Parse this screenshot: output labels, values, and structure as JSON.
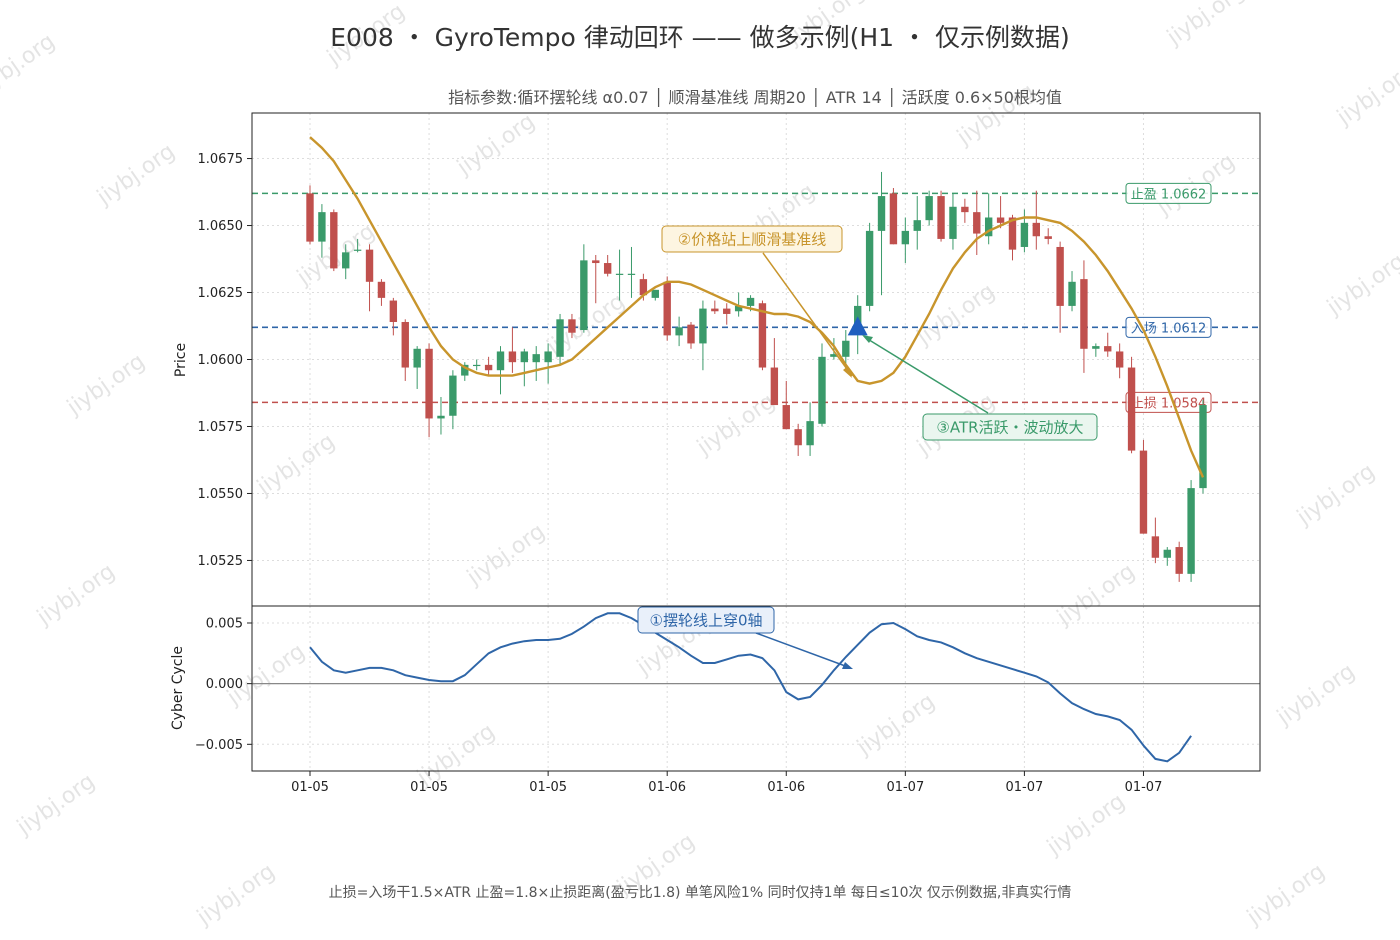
{
  "title": "E008 ・ GyroTempo 律动回环 —— 做多示例(H1 ・ 仅示例数据)",
  "subtitle": "指标参数:循环摆轮线 α0.07 │ 顺滑基准线 周期20 │ ATR 14 │ 活跃度 0.6×50根均值",
  "footer": "止损=入场干1.5×ATR  止盈=1.8×止损距离(盈亏比1.8)  单笔风险1%  同时仅持1单  每日≤10次     仅示例数据,非真实行情",
  "watermark": "jiybj.org",
  "colors": {
    "up": "#3a9a6a",
    "down": "#c0504d",
    "baseline": "#c8952c",
    "cycle": "#2f66a8",
    "take_profit": "#3a9a6a",
    "entry": "#2f66a8",
    "stop_loss": "#c0504d",
    "signal_marker": "#1f5fbf"
  },
  "chart_data": [
    {
      "type": "candlestick",
      "ylabel": "Price",
      "ylim": [
        1.0508,
        1.0692
      ],
      "yticks": [
        1.0525,
        1.055,
        1.0575,
        1.06,
        1.0625,
        1.065,
        1.0675
      ],
      "grid": true,
      "candles": [
        {
          "o": 1.0662,
          "h": 1.0665,
          "l": 1.0643,
          "c": 1.0644
        },
        {
          "o": 1.0644,
          "h": 1.0658,
          "l": 1.0638,
          "c": 1.0655
        },
        {
          "o": 1.0655,
          "h": 1.0656,
          "l": 1.0633,
          "c": 1.0634
        },
        {
          "o": 1.0634,
          "h": 1.0643,
          "l": 1.063,
          "c": 1.064
        },
        {
          "o": 1.0641,
          "h": 1.0645,
          "l": 1.064,
          "c": 1.0641
        },
        {
          "o": 1.0641,
          "h": 1.0643,
          "l": 1.0618,
          "c": 1.0629
        },
        {
          "o": 1.0629,
          "h": 1.063,
          "l": 1.062,
          "c": 1.0623
        },
        {
          "o": 1.0622,
          "h": 1.0623,
          "l": 1.0609,
          "c": 1.0614
        },
        {
          "o": 1.0614,
          "h": 1.0615,
          "l": 1.0592,
          "c": 1.0597
        },
        {
          "o": 1.0597,
          "h": 1.0605,
          "l": 1.0589,
          "c": 1.0604
        },
        {
          "o": 1.0604,
          "h": 1.0606,
          "l": 1.0571,
          "c": 1.0578
        },
        {
          "o": 1.0578,
          "h": 1.0586,
          "l": 1.0572,
          "c": 1.0579
        },
        {
          "o": 1.0579,
          "h": 1.0596,
          "l": 1.0574,
          "c": 1.0594
        },
        {
          "o": 1.0594,
          "h": 1.0599,
          "l": 1.0592,
          "c": 1.0598
        },
        {
          "o": 1.0598,
          "h": 1.06,
          "l": 1.0596,
          "c": 1.0598
        },
        {
          "o": 1.0598,
          "h": 1.0601,
          "l": 1.0594,
          "c": 1.0596
        },
        {
          "o": 1.0596,
          "h": 1.0605,
          "l": 1.0587,
          "c": 1.0603
        },
        {
          "o": 1.0603,
          "h": 1.0612,
          "l": 1.0595,
          "c": 1.0599
        },
        {
          "o": 1.0599,
          "h": 1.0604,
          "l": 1.059,
          "c": 1.0603
        },
        {
          "o": 1.0599,
          "h": 1.0605,
          "l": 1.0592,
          "c": 1.0602
        },
        {
          "o": 1.0599,
          "h": 1.0606,
          "l": 1.0591,
          "c": 1.0603
        },
        {
          "o": 1.0601,
          "h": 1.0617,
          "l": 1.0598,
          "c": 1.0615
        },
        {
          "o": 1.0615,
          "h": 1.0617,
          "l": 1.0608,
          "c": 1.061
        },
        {
          "o": 1.0611,
          "h": 1.0643,
          "l": 1.061,
          "c": 1.0637
        },
        {
          "o": 1.0637,
          "h": 1.0639,
          "l": 1.0621,
          "c": 1.0636
        },
        {
          "o": 1.0636,
          "h": 1.0639,
          "l": 1.0631,
          "c": 1.0632
        },
        {
          "o": 1.0632,
          "h": 1.0641,
          "l": 1.0622,
          "c": 1.0632
        },
        {
          "o": 1.0632,
          "h": 1.0642,
          "l": 1.0623,
          "c": 1.0632
        },
        {
          "o": 1.063,
          "h": 1.0632,
          "l": 1.0622,
          "c": 1.0624
        },
        {
          "o": 1.0623,
          "h": 1.0626,
          "l": 1.0622,
          "c": 1.0626
        },
        {
          "o": 1.0629,
          "h": 1.0631,
          "l": 1.0607,
          "c": 1.0609
        },
        {
          "o": 1.0609,
          "h": 1.0616,
          "l": 1.0605,
          "c": 1.0612
        },
        {
          "o": 1.0613,
          "h": 1.0614,
          "l": 1.0604,
          "c": 1.0606
        },
        {
          "o": 1.0606,
          "h": 1.0622,
          "l": 1.0596,
          "c": 1.0619
        },
        {
          "o": 1.0619,
          "h": 1.0622,
          "l": 1.0617,
          "c": 1.0618
        },
        {
          "o": 1.0619,
          "h": 1.0621,
          "l": 1.0613,
          "c": 1.0617
        },
        {
          "o": 1.0618,
          "h": 1.0625,
          "l": 1.0616,
          "c": 1.062
        },
        {
          "o": 1.062,
          "h": 1.0624,
          "l": 1.0618,
          "c": 1.0623
        },
        {
          "o": 1.0621,
          "h": 1.0622,
          "l": 1.0596,
          "c": 1.0597
        },
        {
          "o": 1.0597,
          "h": 1.0608,
          "l": 1.0583,
          "c": 1.0583
        },
        {
          "o": 1.0583,
          "h": 1.0592,
          "l": 1.0574,
          "c": 1.0574
        },
        {
          "o": 1.0574,
          "h": 1.0576,
          "l": 1.0564,
          "c": 1.0568
        },
        {
          "o": 1.0568,
          "h": 1.0584,
          "l": 1.0564,
          "c": 1.0577
        },
        {
          "o": 1.0576,
          "h": 1.0606,
          "l": 1.0575,
          "c": 1.0601
        },
        {
          "o": 1.0601,
          "h": 1.0608,
          "l": 1.06,
          "c": 1.0602
        },
        {
          "o": 1.0601,
          "h": 1.0611,
          "l": 1.0596,
          "c": 1.0607
        },
        {
          "o": 1.061,
          "h": 1.0624,
          "l": 1.0602,
          "c": 1.062
        },
        {
          "o": 1.062,
          "h": 1.0651,
          "l": 1.0618,
          "c": 1.0648
        },
        {
          "o": 1.0648,
          "h": 1.067,
          "l": 1.0624,
          "c": 1.0661
        },
        {
          "o": 1.0662,
          "h": 1.0664,
          "l": 1.0643,
          "c": 1.0643
        },
        {
          "o": 1.0643,
          "h": 1.0653,
          "l": 1.0636,
          "c": 1.0648
        },
        {
          "o": 1.0648,
          "h": 1.0661,
          "l": 1.0641,
          "c": 1.0652
        },
        {
          "o": 1.0652,
          "h": 1.0663,
          "l": 1.065,
          "c": 1.0661
        },
        {
          "o": 1.0661,
          "h": 1.0663,
          "l": 1.0644,
          "c": 1.0645
        },
        {
          "o": 1.0645,
          "h": 1.0662,
          "l": 1.0641,
          "c": 1.0657
        },
        {
          "o": 1.0657,
          "h": 1.066,
          "l": 1.0651,
          "c": 1.0655
        },
        {
          "o": 1.0655,
          "h": 1.0663,
          "l": 1.0639,
          "c": 1.0647
        },
        {
          "o": 1.0646,
          "h": 1.0662,
          "l": 1.0643,
          "c": 1.0653
        },
        {
          "o": 1.0653,
          "h": 1.0661,
          "l": 1.0649,
          "c": 1.0651
        },
        {
          "o": 1.0653,
          "h": 1.0654,
          "l": 1.0637,
          "c": 1.0641
        },
        {
          "o": 1.0642,
          "h": 1.0656,
          "l": 1.064,
          "c": 1.0651
        },
        {
          "o": 1.0651,
          "h": 1.0663,
          "l": 1.0641,
          "c": 1.0646
        },
        {
          "o": 1.0646,
          "h": 1.0649,
          "l": 1.0643,
          "c": 1.0645
        },
        {
          "o": 1.0642,
          "h": 1.0644,
          "l": 1.061,
          "c": 1.062
        },
        {
          "o": 1.062,
          "h": 1.0633,
          "l": 1.0618,
          "c": 1.0629
        },
        {
          "o": 1.063,
          "h": 1.0637,
          "l": 1.0595,
          "c": 1.0604
        },
        {
          "o": 1.0604,
          "h": 1.0606,
          "l": 1.0601,
          "c": 1.0605
        },
        {
          "o": 1.0605,
          "h": 1.061,
          "l": 1.0601,
          "c": 1.0603
        },
        {
          "o": 1.0603,
          "h": 1.0606,
          "l": 1.0593,
          "c": 1.0597
        },
        {
          "o": 1.0597,
          "h": 1.0601,
          "l": 1.0565,
          "c": 1.0566
        },
        {
          "o": 1.0566,
          "h": 1.057,
          "l": 1.0535,
          "c": 1.0535
        },
        {
          "o": 1.0534,
          "h": 1.0541,
          "l": 1.0524,
          "c": 1.0526
        },
        {
          "o": 1.0526,
          "h": 1.053,
          "l": 1.0523,
          "c": 1.0529
        },
        {
          "o": 1.053,
          "h": 1.0532,
          "l": 1.0517,
          "c": 1.052
        },
        {
          "o": 1.052,
          "h": 1.0555,
          "l": 1.0517,
          "c": 1.0552
        },
        {
          "o": 1.0552,
          "h": 1.0585,
          "l": 1.055,
          "c": 1.0583
        }
      ],
      "baseline_values": [
        1.0683,
        1.0679,
        1.0674,
        1.0667,
        1.066,
        1.0652,
        1.0644,
        1.0636,
        1.0628,
        1.062,
        1.0612,
        1.0605,
        1.06,
        1.0597,
        1.0595,
        1.0594,
        1.0594,
        1.0594,
        1.0595,
        1.0596,
        1.0597,
        1.0598,
        1.06,
        1.0604,
        1.0608,
        1.0612,
        1.0616,
        1.062,
        1.0624,
        1.0627,
        1.0629,
        1.0629,
        1.0628,
        1.0626,
        1.0624,
        1.0622,
        1.062,
        1.0619,
        1.0618,
        1.0617,
        1.0617,
        1.0616,
        1.0614,
        1.061,
        1.0605,
        1.0598,
        1.0592,
        1.0591,
        1.0592,
        1.0595,
        1.0601,
        1.0609,
        1.0617,
        1.0626,
        1.0634,
        1.064,
        1.0645,
        1.0648,
        1.065,
        1.0652,
        1.0653,
        1.0653,
        1.0652,
        1.0651,
        1.0648,
        1.0644,
        1.0639,
        1.0633,
        1.0626,
        1.0619,
        1.0611,
        1.0601,
        1.059,
        1.0578,
        1.0566,
        1.0556
      ],
      "levels": [
        {
          "name": "take_profit",
          "label": "止盈 1.0662",
          "value": 1.0662
        },
        {
          "name": "entry",
          "label": "入场 1.0612",
          "value": 1.0612
        },
        {
          "name": "stop_loss",
          "label": "止损 1.0584",
          "value": 1.0584
        }
      ],
      "signal_index": 46,
      "signal_price": 1.0612,
      "annotations": [
        {
          "name": "annotation-baseline-cross",
          "text": "②价格站上顺滑基准线"
        },
        {
          "name": "annotation-atr-active",
          "text": "③ATR活跃・波动放大"
        }
      ]
    },
    {
      "type": "line",
      "ylabel": "Cyber Cycle",
      "ylim": [
        -0.0072,
        0.0064
      ],
      "yticks": [
        -0.005,
        0.0,
        0.005
      ],
      "grid": true,
      "zero_line": true,
      "values": [
        0.003,
        0.0018,
        0.0011,
        0.0009,
        0.0011,
        0.0013,
        0.0013,
        0.0011,
        0.0007,
        0.0005,
        0.0003,
        0.0002,
        0.0002,
        0.0007,
        0.0016,
        0.0025,
        0.003,
        0.0033,
        0.0035,
        0.0036,
        0.0036,
        0.0037,
        0.0041,
        0.0047,
        0.0054,
        0.0058,
        0.0058,
        0.0054,
        0.0048,
        0.0042,
        0.0036,
        0.003,
        0.0023,
        0.0017,
        0.0017,
        0.002,
        0.0023,
        0.0024,
        0.0021,
        0.0011,
        -0.0007,
        -0.0013,
        -0.0011,
        -0.0001,
        0.0011,
        0.0022,
        0.0032,
        0.0042,
        0.0049,
        0.005,
        0.0045,
        0.0039,
        0.0036,
        0.0034,
        0.003,
        0.0025,
        0.0021,
        0.0018,
        0.0015,
        0.0012,
        0.0009,
        0.0006,
        0.0001,
        -0.0008,
        -0.0016,
        -0.0021,
        -0.0025,
        -0.0027,
        -0.003,
        -0.0038,
        -0.0051,
        -0.0062,
        -0.0064,
        -0.0057,
        -0.0043
      ],
      "annotations": [
        {
          "name": "annotation-cycle-cross",
          "text": "①摆轮线上穿0轴"
        }
      ]
    }
  ],
  "x_tick_labels": [
    "01-05",
    "01-05",
    "01-05",
    "01-06",
    "01-06",
    "01-07",
    "01-07",
    "01-07"
  ]
}
